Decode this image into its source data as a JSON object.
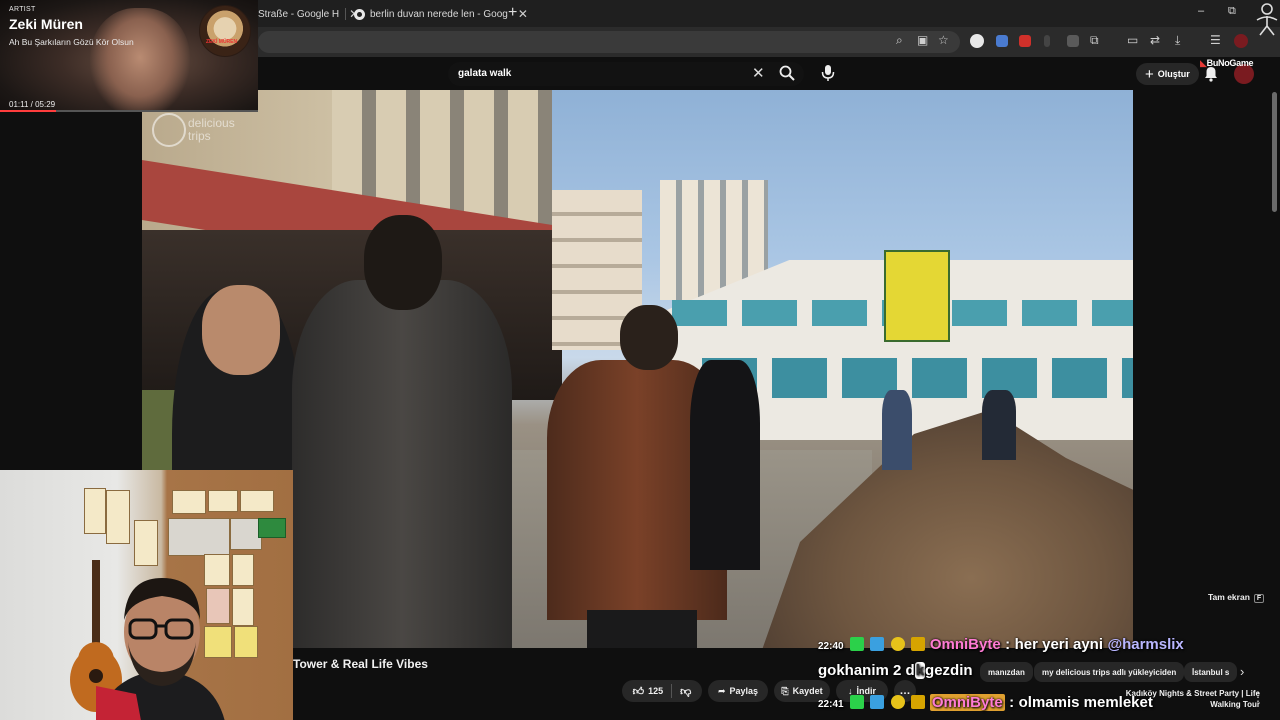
{
  "browser": {
    "tabs": [
      {
        "label": "Straße - Google H"
      },
      {
        "label": "berlin duvan nerede len - Goog"
      }
    ],
    "new_tab": "+",
    "window_controls": [
      "–",
      "⧉",
      "✕"
    ]
  },
  "youtube": {
    "search": {
      "query": "galata walk"
    },
    "create_label": "Oluştur",
    "channel_logo_text": "BuNoGame",
    "video_title": "Tower & Real Life Vibes",
    "fullscreen_hint": "Tam ekran",
    "fullscreen_key": "F",
    "actions": {
      "likes": "125",
      "share": "Paylaş",
      "save": "Kaydet",
      "download": "İndir",
      "more": "…"
    },
    "chips": [
      "manızdan",
      "my delicious trips adlı yükleyiciden",
      "İstanbul s"
    ],
    "next_video": "Kadıköy Nights & Street Party | Life Walking Tour",
    "watermark": {
      "line1": "delicious",
      "line2": "trips"
    }
  },
  "music_overlay": {
    "label": "ARTIST",
    "artist": "Zeki Müren",
    "song": "Ah Bu Şarkıların Gözü Kör Olsun",
    "elapsed": "01:11",
    "duration": "05:29",
    "progress": 0.216
  },
  "chat": {
    "line1": {
      "time": "22:40",
      "user": "OmniByte",
      "sep": ":",
      "text": "her yeri ayni",
      "mention": "@harmslix"
    },
    "line2": {
      "text_a": "gokhanim 2 d",
      "text_blot": "k",
      "text_b": "gezdin"
    },
    "line3": {
      "time": "22:41",
      "user": "OmniByte",
      "sep": ":",
      "text": "olmamis memleket"
    }
  },
  "colors": {
    "chat_user": "#ff7bd4",
    "mention": "#b9b6ff",
    "accent_red": "#ff3d3d"
  }
}
